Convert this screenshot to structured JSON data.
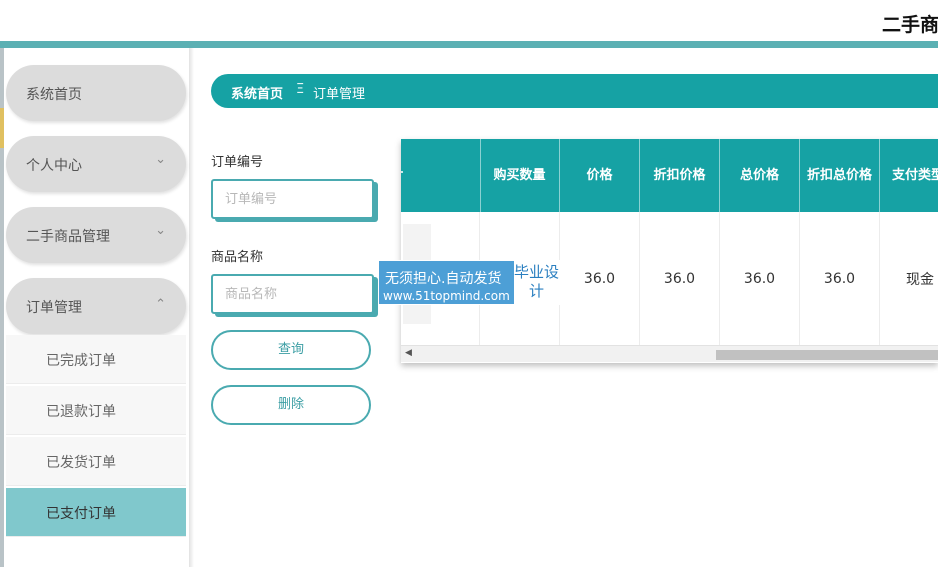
{
  "header": {
    "title": "二手商"
  },
  "sidebar": {
    "menus": [
      {
        "label": "系统首页",
        "chevron": ""
      },
      {
        "label": "个人中心",
        "chevron": "chevron-down"
      },
      {
        "label": "二手商品管理",
        "chevron": "chevron-down"
      },
      {
        "label": "订单管理",
        "chevron": "chevron-up"
      }
    ],
    "sub_items": [
      {
        "label": "已完成订单",
        "active": false
      },
      {
        "label": "已退款订单",
        "active": false
      },
      {
        "label": "已发货订单",
        "active": false
      },
      {
        "label": "已支付订单",
        "active": true
      }
    ]
  },
  "breadcrumb": {
    "home": "系统首页",
    "separator": "Ξ",
    "current": "订单管理"
  },
  "search": {
    "order_no_label": "订单编号",
    "order_no_placeholder": "订单编号",
    "goods_name_label": "商品名称",
    "goods_name_placeholder": "商品名称",
    "query_button": "查询",
    "delete_button": "删除"
  },
  "table": {
    "headers": [
      "片",
      "购买数量",
      "价格",
      "折扣价格",
      "总价格",
      "折扣总价格",
      "支付类型"
    ],
    "rows": [
      {
        "quantity": "",
        "price": "36.0",
        "discount_price": "36.0",
        "total_price": "36.0",
        "discount_total": "36.0",
        "pay_type": "现金"
      }
    ]
  },
  "watermark": {
    "line1": "无须担心.自动发货",
    "line2": "www.51topmind.com",
    "side": "毕业设计"
  },
  "colors": {
    "accent": "#16a2a4",
    "input_border": "#4aaab0",
    "active_menu": "#80c8cc",
    "watermark": "#4d9fd6"
  }
}
